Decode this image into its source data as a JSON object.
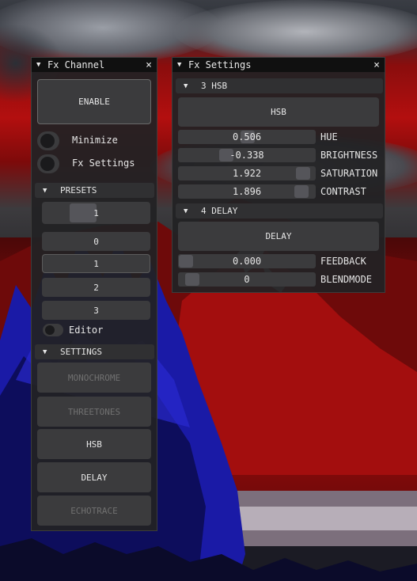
{
  "colors": {
    "window_bg": "#222224",
    "titlebar_bg": "#101010",
    "button_bg": "#3b3b3d",
    "slider_grab": "#55555a",
    "text": "#e6e6e6",
    "text_disabled": "#707070"
  },
  "fx_channel": {
    "title": "Fx Channel",
    "enable_label": "ENABLE",
    "minimize_label": "Minimize",
    "fx_settings_label": "Fx Settings",
    "presets_header": "PRESETS",
    "preset_selected": "1",
    "presets": [
      "0",
      "1",
      "2",
      "3"
    ],
    "editor_label": "Editor",
    "settings_header": "SETTINGS",
    "settings_buttons": {
      "monochrome": "MONOCHROME",
      "threetones": "THREETONES",
      "hsb": "HSB",
      "delay": "DELAY",
      "echotrace": "ECHOTRACE"
    }
  },
  "fx_settings": {
    "title": "Fx Settings",
    "hsb_header": "3 HSB",
    "hsb_button": "HSB",
    "hsb_params": [
      {
        "label": "HUE",
        "value": "0.506",
        "level": 0.506
      },
      {
        "label": "BRIGHTNESS",
        "value": "-0.338",
        "level": 0.33
      },
      {
        "label": "SATURATION",
        "value": "1.922",
        "level": 0.96
      },
      {
        "label": "CONTRAST",
        "value": "1.896",
        "level": 0.95
      }
    ],
    "delay_header": "4 DELAY",
    "delay_button": "DELAY",
    "delay_params": [
      {
        "label": "FEEDBACK",
        "value": "0.000",
        "level": 0.0
      },
      {
        "label": "BLENDMODE",
        "value": "0",
        "level": 0.05
      }
    ]
  },
  "icons": {
    "collapse": "triangle-down-icon",
    "close": "close-icon"
  }
}
